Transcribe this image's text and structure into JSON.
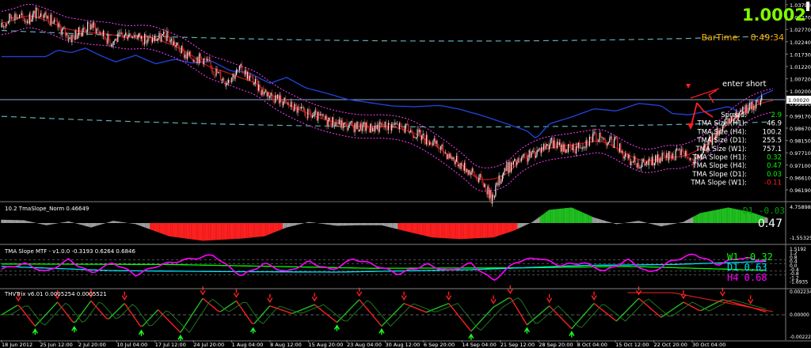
{
  "header": {
    "price": "1.0002",
    "bartime_label": "BarTime:",
    "bartime_value": "0:49:34"
  },
  "annotation": {
    "enter_short": "enter short"
  },
  "stats": [
    {
      "label": "Spread:",
      "value": "2.9",
      "color": "#00ff00"
    },
    {
      "label": "TMA Size (H1):",
      "value": "46.9",
      "color": "#ffffff"
    },
    {
      "label": "TMA Size (H4):",
      "value": "100.2",
      "color": "#ffffff"
    },
    {
      "label": "TMA Size (D1):",
      "value": "255.5",
      "color": "#ffffff"
    },
    {
      "label": "TMA Size (W1):",
      "value": "757.1",
      "color": "#ffffff"
    },
    {
      "label": "TMA Slope (H1):",
      "value": "0.32",
      "color": "#00ff00"
    },
    {
      "label": "TMA Slope (H4):",
      "value": "0.47",
      "color": "#00ff00"
    },
    {
      "label": "TMA Slope (D1):",
      "value": "0.03",
      "color": "#00ff00"
    },
    {
      "label": "TMA Slope (W1):",
      "value": "-0.11",
      "color": "#ff2020"
    }
  ],
  "panels": {
    "main_axis": [
      "1.03790",
      "1.03270",
      "1.02770",
      "1.02240",
      "1.01730",
      "1.01220",
      "1.00720",
      "1.00200",
      "0.99690",
      "0.99170",
      "0.98670",
      "0.98150",
      "0.97710",
      "0.97100",
      "0.96610",
      "0.96190"
    ],
    "current_price_label": "1.00020",
    "p1_title": "10.2 TmaSlope_Norm 0.46649",
    "p1_axis": [
      "4.75898",
      "-1.55325"
    ],
    "p1_overlay": "D1 -0.03",
    "p1_value": "0.47",
    "p2_title": "TMA Slope MTF - v1.0.0 -0.3193 0.6264 0.6846",
    "p2_axis": [
      "1.5192",
      "1.2",
      "0.8",
      "0.4",
      "0.0",
      "-0.4",
      "-0.8",
      "-1.2",
      "-1.6935"
    ],
    "p2_legend": [
      {
        "text": "W1 -0.32",
        "color": "#00ff00"
      },
      {
        "text": "D1  0.63",
        "color": "#00e5ff"
      },
      {
        "text": "H4  0.68",
        "color": "#ff00ff"
      }
    ],
    "p3_title": "THVTrix v6.01 0.0005254 0.0005521",
    "p3_axis": [
      "0.002234",
      "0.00000",
      "-0.002224"
    ]
  },
  "time_axis": [
    "18 Jun 2012",
    "25 Jun 12:00",
    "2 Jul 20:00",
    "10 Jul 04:00",
    "17 Jul 12:00",
    "24 Jul 20:00",
    "1 Aug 04:00",
    "8 Aug 12:00",
    "15 Aug 20:00",
    "23 Aug 04:00",
    "30 Aug 12:00",
    "6 Sep 20:00",
    "14 Sep 04:00",
    "21 Sep 12:00",
    "28 Sep 20:00",
    "8 Oct 04:00",
    "15 Oct 12:00",
    "22 Oct 20:00",
    "30 Oct 04:00"
  ],
  "chart_data": {
    "type": "line",
    "price": {
      "y_range": [
        0.9619,
        1.0379
      ],
      "current": 1.0002,
      "close_keypoints": [
        [
          0,
          1.028
        ],
        [
          10,
          1.033
        ],
        [
          22,
          1.031
        ],
        [
          35,
          1.0345
        ],
        [
          48,
          1.029
        ],
        [
          62,
          1.024
        ],
        [
          80,
          1.029
        ],
        [
          98,
          1.0225
        ],
        [
          115,
          1.026
        ],
        [
          130,
          1.023
        ],
        [
          148,
          1.0245
        ],
        [
          165,
          1.017
        ],
        [
          180,
          1.016
        ],
        [
          200,
          1.0075
        ],
        [
          215,
          1.012
        ],
        [
          232,
          1.004
        ],
        [
          250,
          1.0
        ],
        [
          270,
          0.995
        ],
        [
          290,
          0.9925
        ],
        [
          310,
          0.99
        ],
        [
          330,
          0.9895
        ],
        [
          352,
          0.9905
        ],
        [
          370,
          0.9875
        ],
        [
          386,
          0.9835
        ],
        [
          400,
          0.979
        ],
        [
          415,
          0.974
        ],
        [
          430,
          0.969
        ],
        [
          438,
          0.9625
        ],
        [
          450,
          0.9735
        ],
        [
          470,
          0.978
        ],
        [
          490,
          0.9835
        ],
        [
          510,
          0.981
        ],
        [
          530,
          0.986
        ],
        [
          550,
          0.9835
        ],
        [
          560,
          0.977
        ],
        [
          575,
          0.9755
        ],
        [
          595,
          0.978
        ],
        [
          610,
          0.9805
        ],
        [
          620,
          0.9755
        ],
        [
          640,
          0.988
        ],
        [
          655,
          0.993
        ],
        [
          670,
          0.9975
        ],
        [
          680,
          1.0002
        ]
      ]
    },
    "tma_slope_norm": {
      "overlay": "D1 -0.03",
      "value": 0.47,
      "points": [
        [
          0,
          0.3
        ],
        [
          20,
          0.25
        ],
        [
          40,
          -0.2
        ],
        [
          60,
          0.15
        ],
        [
          80,
          -0.4
        ],
        [
          100,
          0.2
        ],
        [
          120,
          -0.1
        ],
        [
          150,
          -1.2
        ],
        [
          180,
          -1.6
        ],
        [
          215,
          -1.4
        ],
        [
          235,
          -1.2
        ],
        [
          255,
          -0.4
        ],
        [
          275,
          0.1
        ],
        [
          300,
          -0.25
        ],
        [
          320,
          -0.2
        ],
        [
          340,
          -0.2
        ],
        [
          360,
          -0.7
        ],
        [
          385,
          -1.3
        ],
        [
          410,
          -1.45
        ],
        [
          440,
          -1.3
        ],
        [
          458,
          -0.7
        ],
        [
          475,
          0.1
        ],
        [
          490,
          1.2
        ],
        [
          510,
          1.4
        ],
        [
          530,
          0.5
        ],
        [
          550,
          -0.1
        ],
        [
          570,
          0.2
        ],
        [
          590,
          -0.3
        ],
        [
          610,
          0.1
        ],
        [
          625,
          0.9
        ],
        [
          650,
          1.4
        ],
        [
          670,
          1.0
        ],
        [
          685,
          0.47
        ]
      ]
    },
    "tma_slope_mtf": {
      "series": [
        {
          "name": "W1",
          "value": -0.32,
          "points": [
            [
              0,
              0.35
            ],
            [
              150,
              0.3
            ],
            [
              330,
              -0.1
            ],
            [
              470,
              -0.05
            ],
            [
              560,
              0.1
            ],
            [
              685,
              -0.32
            ]
          ]
        },
        {
          "name": "D1",
          "value": 0.63,
          "points": [
            [
              0,
              0.1
            ],
            [
              100,
              -0.35
            ],
            [
              200,
              -0.45
            ],
            [
              300,
              -0.5
            ],
            [
              420,
              -0.25
            ],
            [
              520,
              0.2
            ],
            [
              600,
              0.3
            ],
            [
              685,
              0.63
            ]
          ]
        },
        {
          "name": "H4",
          "value": 0.68,
          "points": [
            [
              0,
              -0.2
            ],
            [
              20,
              0.4
            ],
            [
              40,
              -0.5
            ],
            [
              60,
              0.8
            ],
            [
              80,
              -0.6
            ],
            [
              100,
              0.5
            ],
            [
              120,
              -0.8
            ],
            [
              140,
              0.2
            ],
            [
              160,
              0.7
            ],
            [
              180,
              1.1
            ],
            [
              190,
              1.3
            ],
            [
              200,
              0.3
            ],
            [
              215,
              -0.9
            ],
            [
              235,
              0.4
            ],
            [
              255,
              -0.5
            ],
            [
              275,
              0.6
            ],
            [
              295,
              -0.3
            ],
            [
              315,
              0.9
            ],
            [
              335,
              0.2
            ],
            [
              355,
              -0.7
            ],
            [
              380,
              0.3
            ],
            [
              400,
              -0.4
            ],
            [
              420,
              0.4
            ],
            [
              440,
              -1.4
            ],
            [
              460,
              0.6
            ],
            [
              480,
              1.0
            ],
            [
              500,
              0.2
            ],
            [
              520,
              0.5
            ],
            [
              540,
              -0.4
            ],
            [
              560,
              0.8
            ],
            [
              580,
              -0.6
            ],
            [
              600,
              0.7
            ],
            [
              620,
              1.4
            ],
            [
              640,
              0.3
            ],
            [
              660,
              1.0
            ],
            [
              685,
              0.68
            ]
          ]
        }
      ]
    },
    "thvtrix": {
      "values": [
        0.0005254,
        0.0005521
      ],
      "points": [
        [
          0,
          0.0
        ],
        [
          15,
          0.8
        ],
        [
          30,
          -0.9
        ],
        [
          50,
          1.0
        ],
        [
          65,
          -0.7
        ],
        [
          80,
          1.1
        ],
        [
          95,
          -0.4
        ],
        [
          110,
          0.9
        ],
        [
          125,
          -1.0
        ],
        [
          140,
          0.4
        ],
        [
          160,
          -1.4
        ],
        [
          180,
          1.3
        ],
        [
          195,
          0.2
        ],
        [
          210,
          1.1
        ],
        [
          225,
          -0.8
        ],
        [
          240,
          0.7
        ],
        [
          260,
          0.1
        ],
        [
          280,
          0.8
        ],
        [
          300,
          -0.6
        ],
        [
          320,
          1.2
        ],
        [
          340,
          -0.9
        ],
        [
          360,
          0.9
        ],
        [
          380,
          0.2
        ],
        [
          400,
          0.9
        ],
        [
          420,
          -1.3
        ],
        [
          440,
          0.6
        ],
        [
          455,
          1.4
        ],
        [
          470,
          -0.8
        ],
        [
          490,
          0.7
        ],
        [
          510,
          -1.1
        ],
        [
          530,
          0.9
        ],
        [
          550,
          -0.5
        ],
        [
          570,
          1.3
        ],
        [
          590,
          -0.2
        ],
        [
          610,
          1.0
        ],
        [
          625,
          0.3
        ],
        [
          645,
          1.2
        ],
        [
          670,
          0.6
        ],
        [
          685,
          0.2
        ]
      ]
    }
  }
}
